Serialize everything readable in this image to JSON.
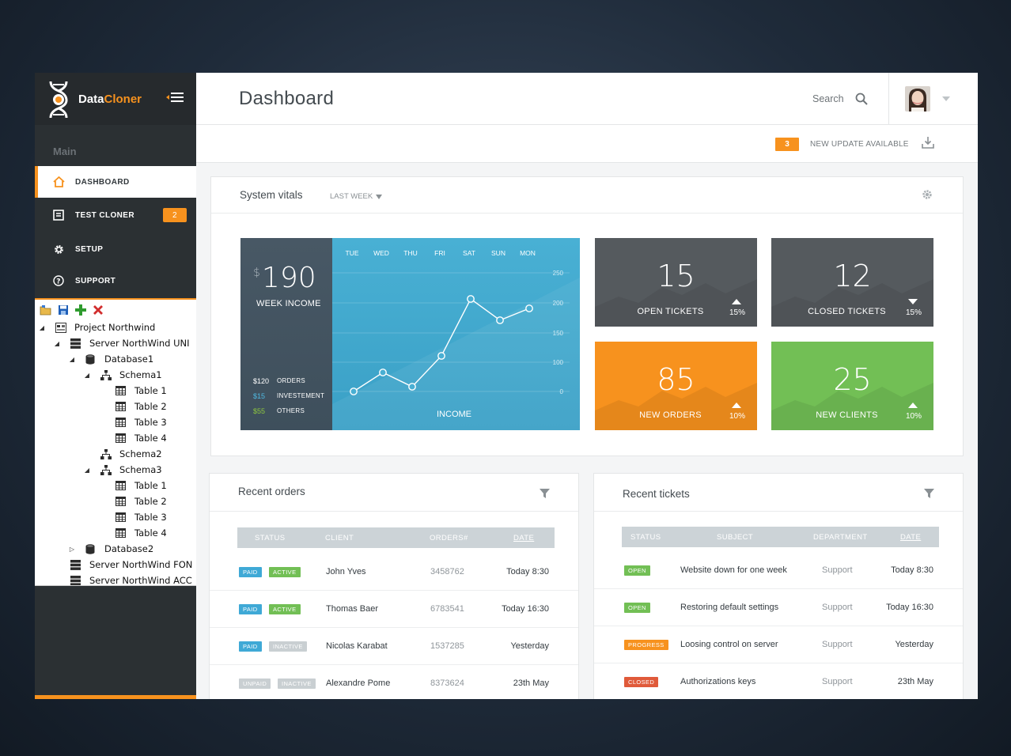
{
  "brand": {
    "name_part1": "Data",
    "name_part2": "Cloner"
  },
  "sidebar": {
    "section_label": "Main",
    "items": [
      {
        "label": "DASHBOARD",
        "icon": "home-icon"
      },
      {
        "label": "TEST CLONER",
        "icon": "document-icon",
        "badge": "2"
      },
      {
        "label": "SETUP",
        "icon": "gear-icon"
      },
      {
        "label": "SUPPORT",
        "icon": "question-icon"
      }
    ],
    "tree": [
      {
        "label": "Project Northwind",
        "level": 0,
        "icon": "project-icon",
        "exp": "▲"
      },
      {
        "label": "Server NorthWind UNI",
        "level": 1,
        "icon": "server-icon",
        "exp": "▲"
      },
      {
        "label": "Database1",
        "level": 2,
        "icon": "database-icon",
        "exp": "▲"
      },
      {
        "label": "Schema1",
        "level": 3,
        "icon": "schema-icon",
        "exp": "▲"
      },
      {
        "label": "Table 1",
        "level": 4,
        "icon": "table-icon"
      },
      {
        "label": "Table 2",
        "level": 4,
        "icon": "table-icon"
      },
      {
        "label": "Table 3",
        "level": 4,
        "icon": "table-icon"
      },
      {
        "label": "Table 4",
        "level": 4,
        "icon": "table-icon"
      },
      {
        "label": "Schema2",
        "level": 3,
        "icon": "schema-icon"
      },
      {
        "label": "Schema3",
        "level": 3,
        "icon": "schema-icon",
        "exp": "▲"
      },
      {
        "label": "Table 1",
        "level": 4,
        "icon": "table-icon"
      },
      {
        "label": "Table 2",
        "level": 4,
        "icon": "table-icon"
      },
      {
        "label": "Table 3",
        "level": 4,
        "icon": "table-icon"
      },
      {
        "label": "Table 4",
        "level": 4,
        "icon": "table-icon"
      },
      {
        "label": "Database2",
        "level": 2,
        "icon": "database-icon",
        "exp": "▷"
      },
      {
        "label": "Server NorthWind FON",
        "level": 1,
        "icon": "server-icon"
      },
      {
        "label": "Server NorthWind ACC",
        "level": 1,
        "icon": "server-icon"
      }
    ]
  },
  "header": {
    "title": "Dashboard",
    "search_label": "Search"
  },
  "update": {
    "count": "3",
    "text": "NEW UPDATE AVAILABLE"
  },
  "vitals": {
    "title": "System vitals",
    "range": "LAST WEEK",
    "income": {
      "currency": "$",
      "value": "190",
      "label": "WEEK INCOME",
      "breakdown": [
        {
          "value": "$120",
          "label": "ORDERS",
          "color": "#ffffff"
        },
        {
          "value": "$15",
          "label": "INVESTEMENT",
          "color": "#4fb8e0"
        },
        {
          "value": "$55",
          "label": "OTHERS",
          "color": "#8dc63f"
        }
      ],
      "chart_label": "INCOME"
    },
    "tiles": [
      {
        "value": "15",
        "label": "OPEN TICKETS",
        "pct": "15%",
        "dir": "up",
        "color": "#555a5e"
      },
      {
        "value": "12",
        "label": "CLOSED TICKETS",
        "pct": "15%",
        "dir": "down",
        "color": "#555a5e"
      },
      {
        "value": "85",
        "label": "NEW ORDERS",
        "pct": "10%",
        "dir": "up",
        "color": "#f7921e"
      },
      {
        "value": "25",
        "label": "NEW CLIENTS",
        "pct": "10%",
        "dir": "up",
        "color": "#72bf55"
      }
    ]
  },
  "chart_data": {
    "type": "line",
    "categories": [
      "TUE",
      "WED",
      "THU",
      "FRI",
      "SAT",
      "SUN",
      "MON"
    ],
    "values": [
      0,
      40,
      10,
      75,
      195,
      150,
      175
    ],
    "ylim": [
      0,
      250
    ],
    "yticks": [
      "250",
      "200",
      "150",
      "100",
      "0"
    ],
    "xlabel": "INCOME",
    "grid": true
  },
  "orders": {
    "title": "Recent orders",
    "columns": [
      "STATUS",
      "CLIENT",
      "ORDERS#",
      "DATE"
    ],
    "rows": [
      {
        "pay": "PAID",
        "pay_color": "#3fa9d6",
        "state": "ACTIVE",
        "state_color": "#72bf55",
        "client": "John Yves",
        "order": "3458762",
        "date": "Today 8:30"
      },
      {
        "pay": "PAID",
        "pay_color": "#3fa9d6",
        "state": "ACTIVE",
        "state_color": "#72bf55",
        "client": "Thomas Baer",
        "order": "6783541",
        "date": "Today 16:30"
      },
      {
        "pay": "PAID",
        "pay_color": "#3fa9d6",
        "state": "INACTIVE",
        "state_color": "#c9cfd2",
        "client": "Nicolas Karabat",
        "order": "1537285",
        "date": "Yesterday"
      },
      {
        "pay": "UNPAID",
        "pay_color": "#c9cfd2",
        "state": "INACTIVE",
        "state_color": "#c9cfd2",
        "client": "Alexandre Pome",
        "order": "8373624",
        "date": "23th May"
      }
    ]
  },
  "tickets": {
    "title": "Recent tickets",
    "columns": [
      "STATUS",
      "SUBJECT",
      "DEPARTMENT",
      "DATE"
    ],
    "rows": [
      {
        "status": "OPEN",
        "color": "#72bf55",
        "subject": "Website down for one week",
        "dept": "Support",
        "date": "Today 8:30"
      },
      {
        "status": "OPEN",
        "color": "#72bf55",
        "subject": "Restoring default settings",
        "dept": "Support",
        "date": "Today 16:30"
      },
      {
        "status": "PROGRESS",
        "color": "#f7921e",
        "subject": "Loosing control on server",
        "dept": "Support",
        "date": "Yesterday"
      },
      {
        "status": "CLOSED",
        "color": "#e05a3a",
        "subject": "Authorizations keys",
        "dept": "Support",
        "date": "23th May"
      }
    ]
  }
}
